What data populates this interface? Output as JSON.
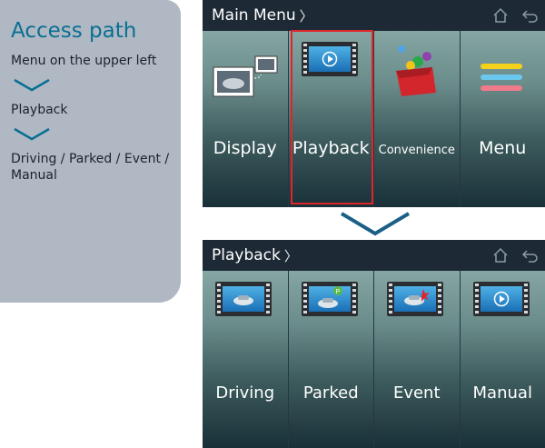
{
  "side_panel": {
    "title": "Access path",
    "step1": "Menu on the upper left",
    "step2": "Playback",
    "step3": "Driving / Parked / Event / Manual"
  },
  "main_menu": {
    "title": "Main Menu",
    "tiles": [
      {
        "label": "Display",
        "icon": "display-icon"
      },
      {
        "label": "Playback",
        "icon": "playback-icon"
      },
      {
        "label": "Convenience",
        "icon": "convenience-icon"
      },
      {
        "label": "Menu",
        "icon": "menu-icon"
      }
    ]
  },
  "playback_menu": {
    "title": "Playback",
    "tiles": [
      {
        "label": "Driving",
        "icon": "driving-video-icon"
      },
      {
        "label": "Parked",
        "icon": "parked-video-icon"
      },
      {
        "label": "Event",
        "icon": "event-video-icon"
      },
      {
        "label": "Manual",
        "icon": "manual-video-icon"
      }
    ]
  },
  "colors": {
    "accent_title": "#0a6f93",
    "highlight": "#e0252b",
    "arrow": "#1a5f86"
  }
}
